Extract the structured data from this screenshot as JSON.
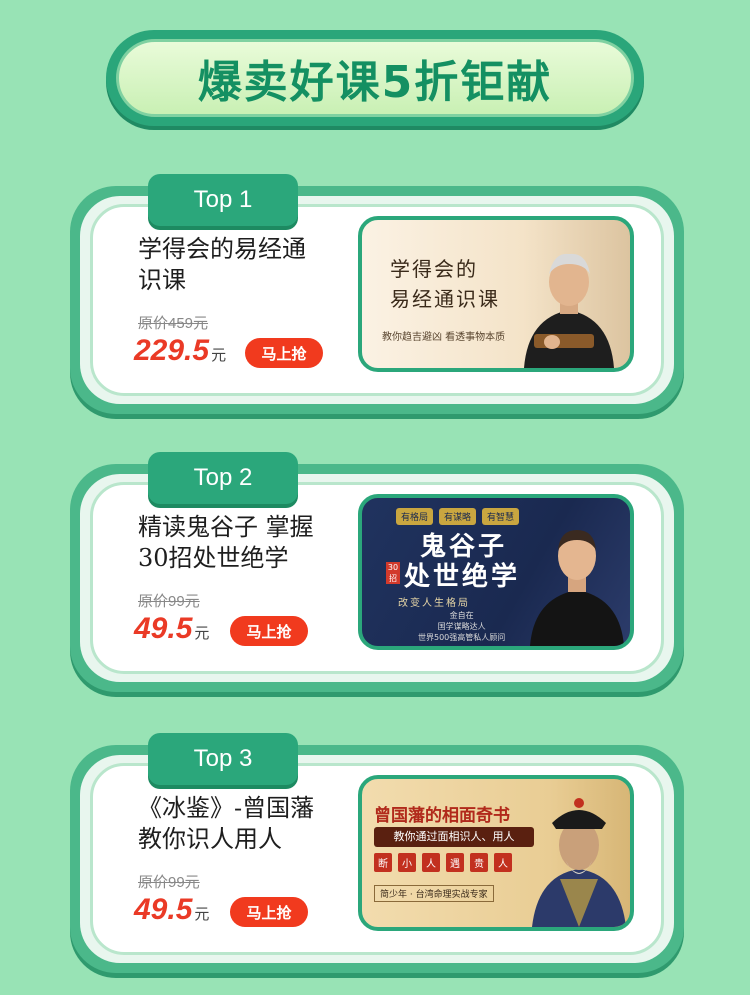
{
  "header": {
    "title": "爆卖好课5折钜献"
  },
  "courses": [
    {
      "rank": "Top 1",
      "title_line1": "学得会的易经通",
      "title_line2": "识课",
      "original_price": "原价459元",
      "price": "229.5",
      "unit": "元",
      "buy_label": "马上抢",
      "thumb": {
        "main_line1": "学得会的",
        "main_line2": "易经通识课",
        "sub": "教你趋吉避凶 看透事物本质"
      }
    },
    {
      "rank": "Top 2",
      "title_line1": "精读鬼谷子 掌握",
      "title_line2": "30招处世绝学",
      "original_price": "原价99元",
      "price": "49.5",
      "unit": "元",
      "buy_label": "马上抢",
      "thumb": {
        "chips": [
          "有格局",
          "有谋略",
          "有智慧"
        ],
        "main_line1": "鬼谷子",
        "main_line2": "处世绝学",
        "badge": "30招",
        "sub": "改变人生格局",
        "info_line1": "金自在",
        "info_line2": "国学谋略达人",
        "info_line3": "世界500强高管私人顾问"
      }
    },
    {
      "rank": "Top 3",
      "title_line1": "《冰鉴》-曾国藩",
      "title_line2": "教你识人用人",
      "original_price": "原价99元",
      "price": "49.5",
      "unit": "元",
      "buy_label": "马上抢",
      "thumb": {
        "main": "曾国藩的相面奇书",
        "band": "教你通过面相识人、用人",
        "words": [
          "断",
          "小",
          "人",
          "遇",
          "贵",
          "人"
        ],
        "sub": "简少年 · 台湾命理实战专家"
      }
    }
  ]
}
